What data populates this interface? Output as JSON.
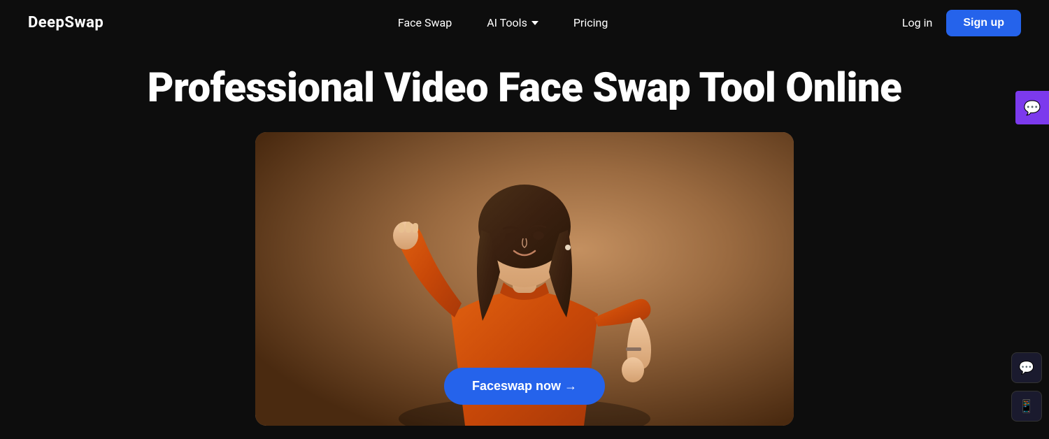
{
  "brand": {
    "name": "DeepSwap",
    "logo_text": "DeepSwap"
  },
  "nav": {
    "face_swap_label": "Face Swap",
    "ai_tools_label": "AI Tools",
    "pricing_label": "Pricing",
    "login_label": "Log in",
    "signup_label": "Sign up"
  },
  "hero": {
    "title": "Professional Video Face Swap Tool Online",
    "cta_button": "Faceswap now →"
  },
  "sidebar": {
    "chat_icon": "💬",
    "message_icon": "💬",
    "app_icon": "📱"
  },
  "colors": {
    "background": "#0d0d0d",
    "accent_blue": "#2563eb",
    "accent_purple": "#7c3aed",
    "nav_bg": "#0d0d0d"
  }
}
